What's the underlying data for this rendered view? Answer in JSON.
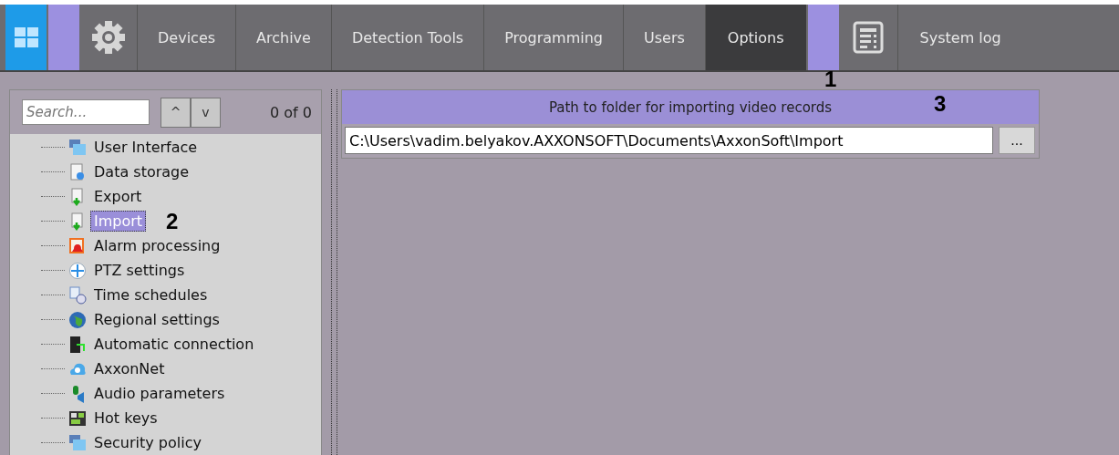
{
  "nav": {
    "tabs": [
      {
        "label": "Devices",
        "selected": false
      },
      {
        "label": "Archive",
        "selected": false
      },
      {
        "label": "Detection Tools",
        "selected": false
      },
      {
        "label": "Programming",
        "selected": false
      },
      {
        "label": "Users",
        "selected": false
      },
      {
        "label": "Options",
        "selected": true
      }
    ],
    "system_log": "System log"
  },
  "search": {
    "placeholder": "Search...",
    "up": "^",
    "down": "v",
    "count": "0 of 0"
  },
  "tree": {
    "items": [
      {
        "label": "User Interface",
        "selected": false
      },
      {
        "label": "Data storage",
        "selected": false
      },
      {
        "label": "Export",
        "selected": false
      },
      {
        "label": "Import",
        "selected": true
      },
      {
        "label": "Alarm processing",
        "selected": false
      },
      {
        "label": "PTZ settings",
        "selected": false
      },
      {
        "label": "Time schedules",
        "selected": false
      },
      {
        "label": "Regional settings",
        "selected": false
      },
      {
        "label": "Automatic connection",
        "selected": false
      },
      {
        "label": "AxxonNet",
        "selected": false
      },
      {
        "label": "Audio parameters",
        "selected": false
      },
      {
        "label": "Hot keys",
        "selected": false
      },
      {
        "label": "Security policy",
        "selected": false
      }
    ]
  },
  "import_panel": {
    "header": "Path to folder for importing video records",
    "path": "C:\\Users\\vadim.belyakov.AXXONSOFT\\Documents\\AxxonSoft\\Import",
    "browse": "..."
  },
  "annotations": [
    "1",
    "2",
    "3"
  ]
}
